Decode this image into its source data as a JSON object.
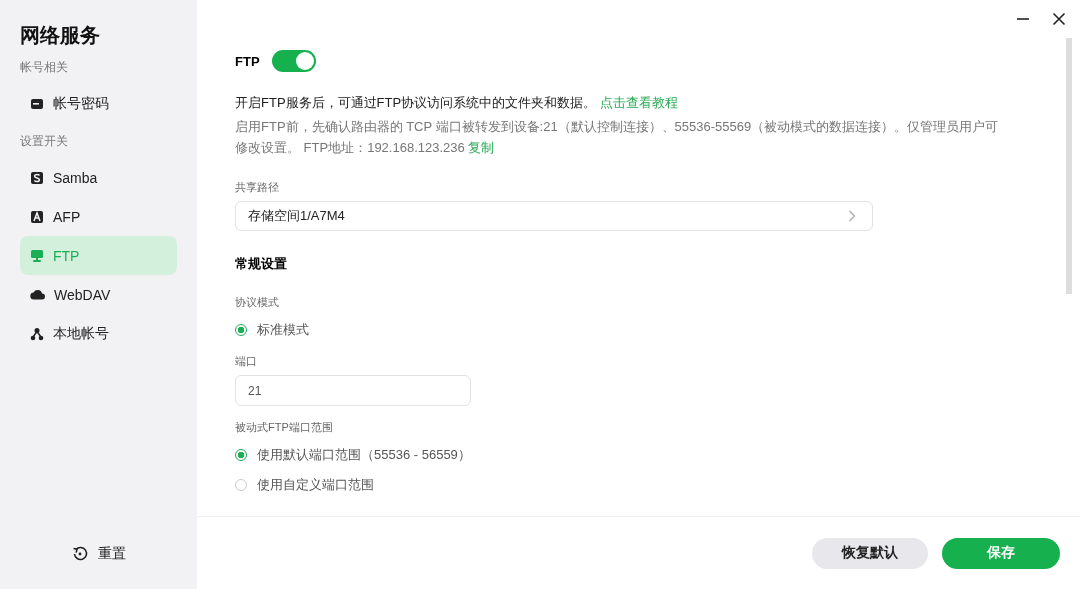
{
  "sidebar": {
    "title": "网络服务",
    "sections": [
      {
        "heading": "帐号相关",
        "items": [
          {
            "label": "帐号密码",
            "kind": "card",
            "selected": false
          }
        ]
      },
      {
        "heading": "设置开关",
        "items": [
          {
            "label": "Samba",
            "kind": "samba",
            "selected": false
          },
          {
            "label": "AFP",
            "kind": "afp",
            "selected": false
          },
          {
            "label": "FTP",
            "kind": "ftp",
            "selected": true
          },
          {
            "label": "WebDAV",
            "kind": "cloud",
            "selected": false
          },
          {
            "label": "本地帐号",
            "kind": "network",
            "selected": false
          }
        ]
      }
    ],
    "reset_button": "重置"
  },
  "service": {
    "label": "FTP",
    "on": true
  },
  "intro": {
    "text": "开启FTP服务后，可通过FTP协议访问系统中的文件夹和数据。",
    "link": "点击查看教程"
  },
  "note": {
    "text": "启用FTP前，先确认路由器的 TCP 端口被转发到设备:21（默认控制连接）、55536-55569（被动模式的数据连接）。仅管理员用户可修改设置。 FTP地址：192.168.123.236",
    "link": "复制"
  },
  "share_path": {
    "label": "共享路径",
    "value": "存储空间1/A7M4"
  },
  "general_heading": "常规设置",
  "protocol": {
    "label": "协议模式",
    "options": [
      {
        "label": "标准模式",
        "selected": true
      }
    ]
  },
  "port": {
    "label": "端口",
    "value": "21"
  },
  "passive": {
    "label": "被动式FTP端口范围",
    "options": [
      {
        "label": "使用默认端口范围（55536 - 56559）",
        "selected": true
      },
      {
        "label": "使用自定义端口范围",
        "selected": false
      }
    ]
  },
  "footer": {
    "restore_button": "恢复默认",
    "save_button": "保存"
  }
}
